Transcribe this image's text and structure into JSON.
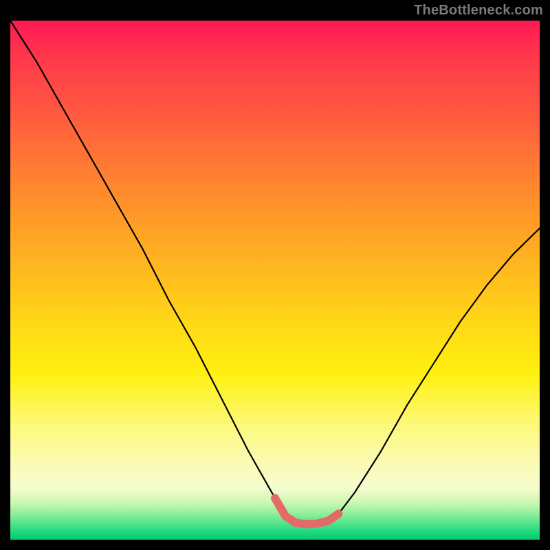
{
  "watermark": "TheBottleneck.com",
  "chart_data": {
    "type": "line",
    "title": "",
    "xlabel": "",
    "ylabel": "",
    "xlim": [
      0,
      100
    ],
    "ylim": [
      0,
      100
    ],
    "grid": false,
    "series": [
      {
        "name": "bottleneck-curve",
        "note": "V-shaped curve; x is normalized horizontal position (0-100 across plot), y is normalized height (0=bottom, 100=top). Values estimated from pixels since chart has no axes.",
        "x": [
          0,
          5,
          10,
          15,
          20,
          25,
          30,
          35,
          40,
          45,
          50,
          52,
          54,
          56,
          58,
          60,
          62,
          65,
          70,
          75,
          80,
          85,
          90,
          95,
          100
        ],
        "y": [
          100,
          92,
          83,
          74,
          65,
          56,
          46,
          37,
          27,
          17,
          8,
          4.5,
          3.2,
          3.0,
          3.1,
          3.6,
          5,
          9,
          17,
          26,
          34,
          42,
          49,
          55,
          60
        ]
      },
      {
        "name": "highlight-segment",
        "note": "Thick pinkish-red overlay near the valley floor (approx x 50–62).",
        "x": [
          50,
          52,
          54,
          56,
          58,
          60,
          62
        ],
        "y": [
          8,
          4.5,
          3.2,
          3.0,
          3.1,
          3.6,
          5
        ]
      }
    ],
    "colors": {
      "curve": "#000000",
      "highlight": "#e46a6a"
    }
  }
}
